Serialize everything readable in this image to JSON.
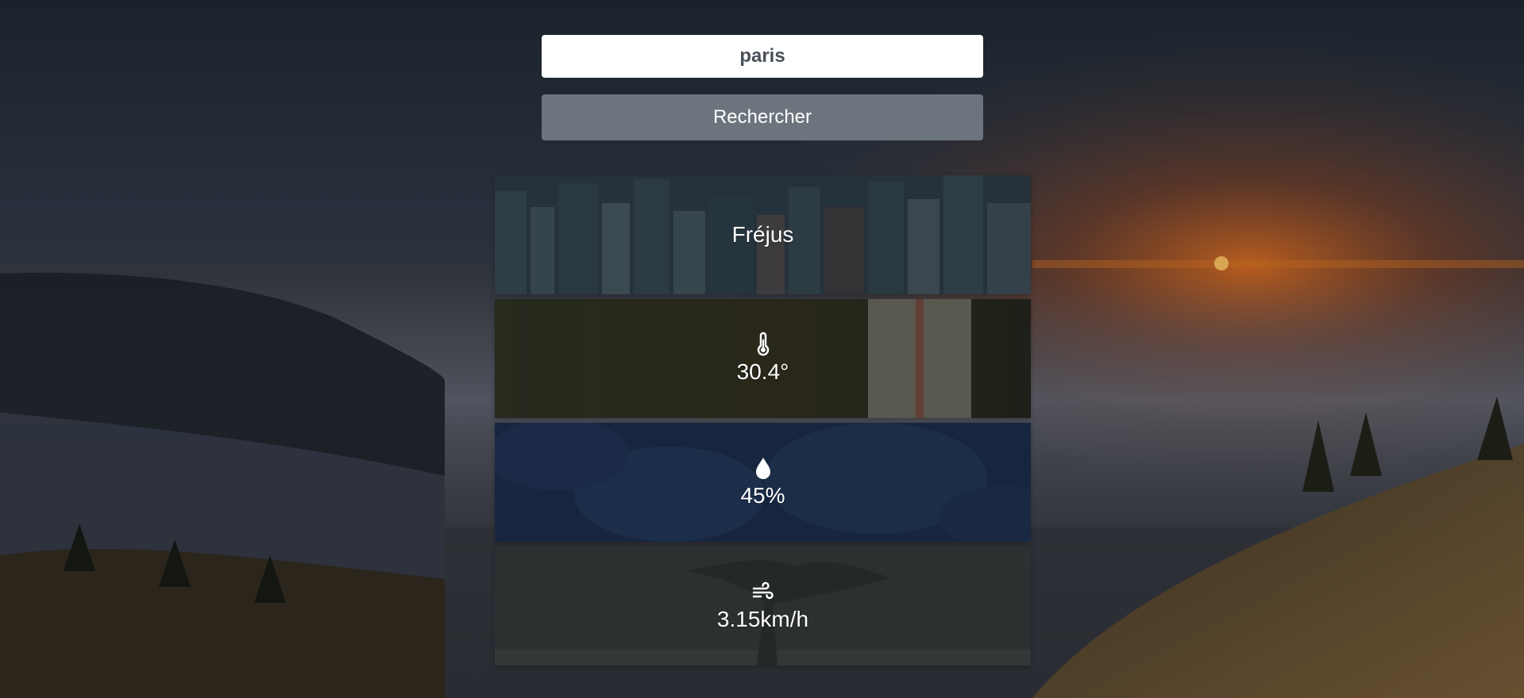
{
  "search": {
    "value": "paris"
  },
  "search_button": {
    "label": "Rechercher"
  },
  "city": {
    "name": "Fréjus"
  },
  "temperature": {
    "value": "30.4°",
    "icon": "thermometer-icon"
  },
  "humidity": {
    "value": "45%",
    "icon": "water-drop-icon"
  },
  "wind": {
    "value": "3.15km/h",
    "icon": "wind-icon"
  },
  "colors": {
    "button_bg": "#6c757d",
    "input_bg": "#ffffff",
    "text": "#ffffff"
  }
}
